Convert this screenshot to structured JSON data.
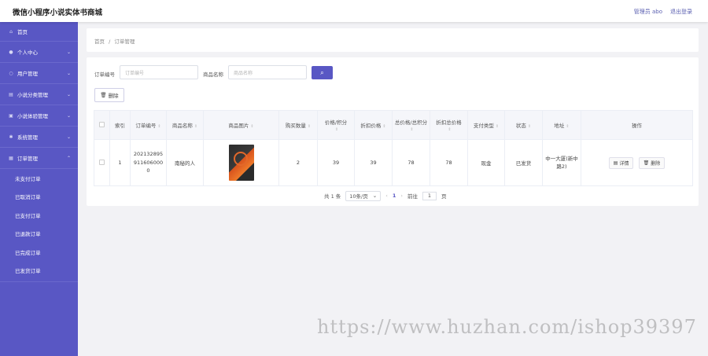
{
  "header": {
    "title": "微信小程序小说实体书商城",
    "user": "管理员 abo",
    "logout": "退出登录"
  },
  "sidebar": {
    "items": [
      {
        "label": "首页",
        "icon": "home-icon"
      },
      {
        "label": "个人中心",
        "icon": "user-icon"
      },
      {
        "label": "用户管理",
        "icon": "bulb-icon"
      },
      {
        "label": "小说分类管理",
        "icon": "list-icon"
      },
      {
        "label": "小说体验管理",
        "icon": "box-icon"
      },
      {
        "label": "系统管理",
        "icon": "gear-icon"
      },
      {
        "label": "订单管理",
        "icon": "order-icon"
      }
    ],
    "subitems": [
      "未支付订单",
      "已取消订单",
      "已支付订单",
      "已退款订单",
      "已完成订单",
      "已发货订单"
    ]
  },
  "breadcrumb": {
    "home": "首页",
    "sep": "/",
    "current": "订单管理"
  },
  "filters": {
    "order_label": "订单编号",
    "order_placeholder": "订单编号",
    "goods_label": "商品名称",
    "goods_placeholder": "商品名称"
  },
  "toolbar": {
    "delete_label": "删除"
  },
  "table": {
    "headers": [
      "索引",
      "订单编号",
      "商品名称",
      "商品图片",
      "购买数量",
      "价格/积分",
      "折扣价格",
      "总价格/总积分",
      "折扣总价格",
      "支付类型",
      "状态",
      "地址",
      "操作"
    ],
    "rows": [
      {
        "index": "1",
        "order_no": "2021328959116060000",
        "goods": "南秘的人",
        "qty": "2",
        "price": "39",
        "discount": "39",
        "total": "78",
        "discount_total": "78",
        "pay_type": "现金",
        "status": "已发货",
        "address": "中一大厦(新中路2)",
        "detail": "详情",
        "delete": "删除"
      }
    ]
  },
  "pagination": {
    "total": "共 1 条",
    "page_size": "10条/页",
    "page": "1",
    "goto": "前往",
    "goto_value": "1",
    "page_unit": "页"
  },
  "watermark": "https://www.huzhan.com/ishop39397"
}
